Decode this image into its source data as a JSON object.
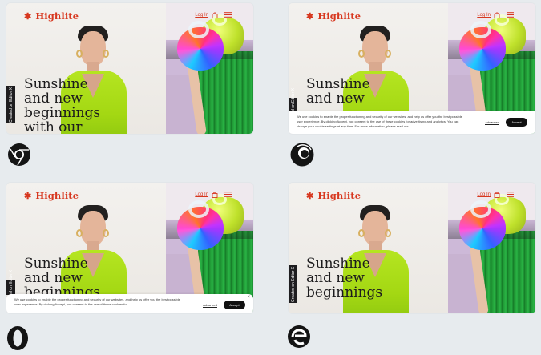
{
  "cards": [
    {
      "brand": "Highlite",
      "login": "Log In",
      "headline": "Sunshine\nand new\nbeginnings\nwith our",
      "badge": "Created on Editor X",
      "cookie": null
    },
    {
      "brand": "Highlite",
      "login": "Log In",
      "headline": "Sunshine\nand new",
      "badge": "Created on Editor X",
      "cookie": {
        "text": "We use cookies to enable the proper functioning and security of our websites, and help us offer you the best possible user experience. By clicking Accept, you consent to the use of these cookies for advertising and analytics. You can change your cookie settings at any time. For more information, please read our",
        "advanced": "Advanced",
        "accept": "Accept"
      }
    },
    {
      "brand": "Highlite",
      "login": "Log In",
      "headline": "Sunshine\nand new\nbeginnings",
      "badge": "Created on Editor X",
      "cookie": {
        "text": "We use cookies to enable the proper functioning and security of our websites, and help us offer you the best possible user experience. By clicking Accept, you consent to the use of these cookies for",
        "advanced": "Advanced",
        "accept": "Accept"
      }
    },
    {
      "brand": "Highlite",
      "login": "Log In",
      "headline": "Sunshine\nand new\nbeginnings",
      "badge": "Created on Editor X",
      "cookie": null
    }
  ],
  "browsers": [
    {
      "icon": "chrome-icon"
    },
    {
      "icon": "firefox-icon"
    },
    {
      "icon": "opera-icon"
    },
    {
      "icon": "edge-icon"
    }
  ],
  "colors": {
    "brand": "#d7371f",
    "background": "#e7ebee",
    "jacket": "#a4d813"
  }
}
